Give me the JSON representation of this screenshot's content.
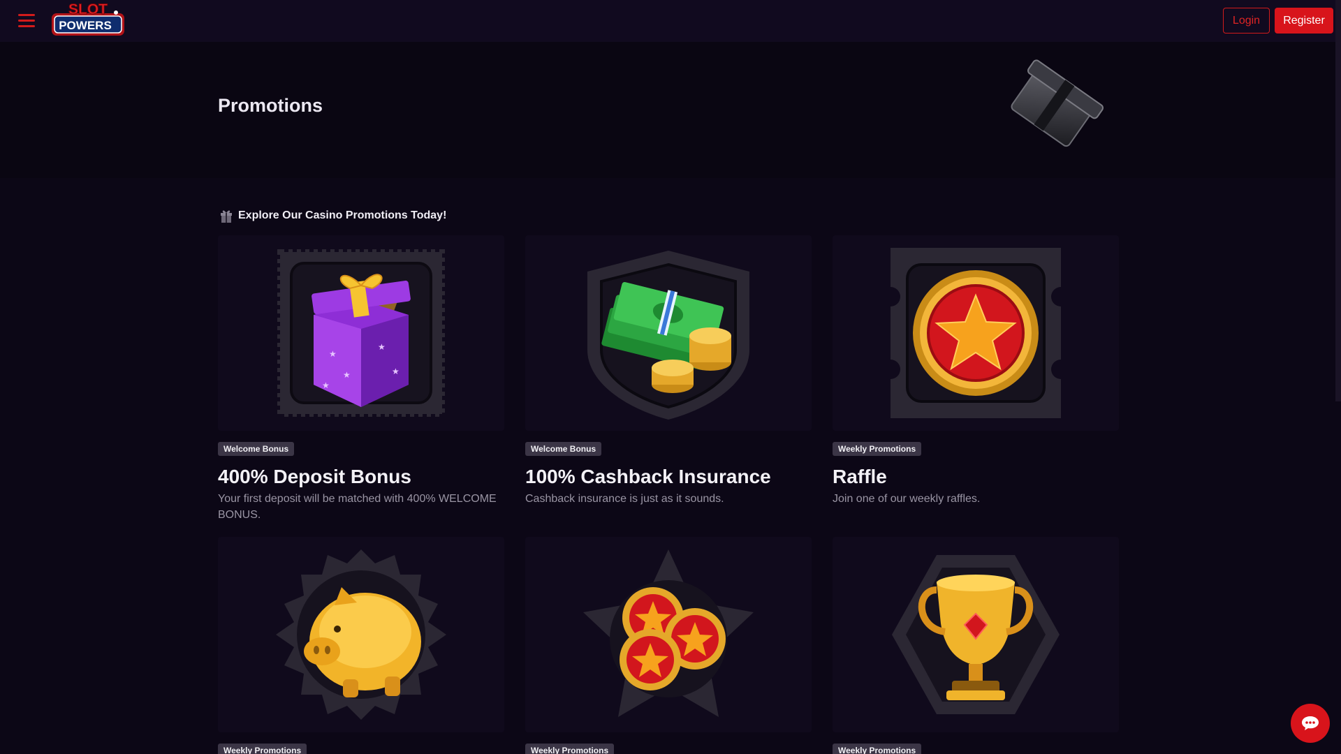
{
  "header": {
    "logo_line1": "SLOT",
    "logo_line2": "POWERS",
    "login_label": "Login",
    "register_label": "Register"
  },
  "hero": {
    "title": "Promotions"
  },
  "section": {
    "heading": "Explore Our Casino Promotions Today!"
  },
  "promotions": [
    {
      "badge": "Welcome Bonus",
      "title": "400% Deposit Bonus",
      "description": "Your first deposit will be matched with 400% WELCOME BONUS.",
      "icon": "gift-box-icon"
    },
    {
      "badge": "Welcome Bonus",
      "title": "100% Cashback Insurance",
      "description": "Cashback insurance is just as it sounds.",
      "icon": "cash-stack-icon"
    },
    {
      "badge": "Weekly Promotions",
      "title": "Raffle",
      "description": "Join one of our weekly raffles.",
      "icon": "star-coin-icon"
    },
    {
      "badge": "Weekly Promotions",
      "title": "",
      "description": "",
      "icon": "piggy-bank-icon"
    },
    {
      "badge": "Weekly Promotions",
      "title": "",
      "description": "",
      "icon": "coins-icon"
    },
    {
      "badge": "Weekly Promotions",
      "title": "",
      "description": "",
      "icon": "trophy-icon"
    }
  ],
  "colors": {
    "accent": "#d8141b",
    "background": "#0c0716",
    "card": "#100a1c",
    "badge": "#3b3546"
  }
}
